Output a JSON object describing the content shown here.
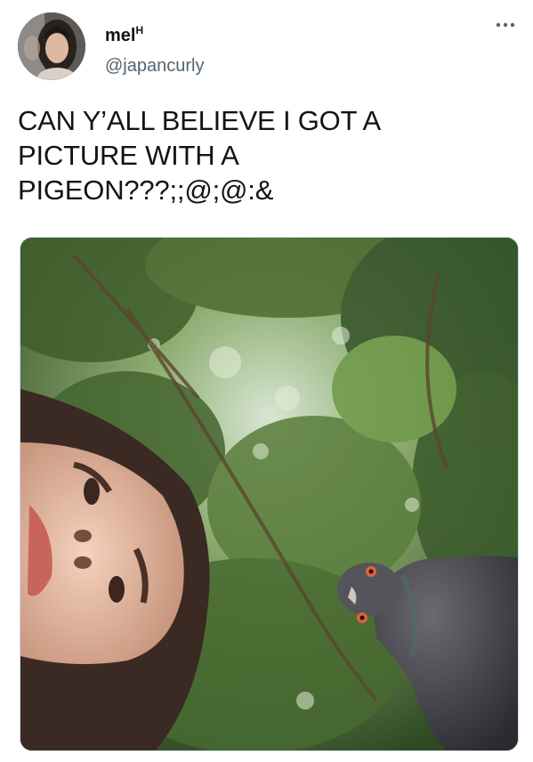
{
  "author": {
    "display_name": "mel",
    "display_name_suffix": "H",
    "handle": "@japancurly",
    "avatar_icon": "user-avatar-photo"
  },
  "menu": {
    "icon": "more-horizontal-icon"
  },
  "tweet": {
    "text": "CAN Y’ALL BELIEVE I GOT A\nPICTURE WITH A\nPIGEON???;;@;@:&"
  },
  "media": {
    "type": "photo",
    "subject_icon": "selfie-with-pigeon-photo"
  },
  "colors": {
    "text_primary": "#0f1419",
    "text_secondary": "#536471",
    "border": "#cfd9de",
    "background": "#ffffff"
  }
}
